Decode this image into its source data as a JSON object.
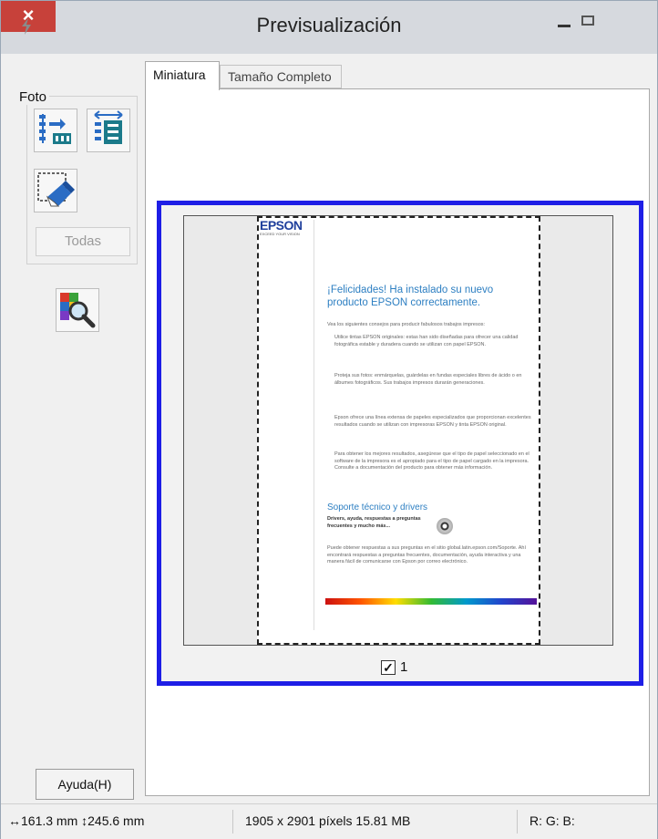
{
  "window": {
    "title": "Previsualización",
    "close_glyph": "×"
  },
  "sidebar": {
    "group_label": "Foto",
    "all_button_label": "Todas",
    "help_button_label": "Ayuda(H)",
    "tool_icons": [
      "auto-locate-icon",
      "size-icon",
      "marquee-delete-icon",
      "color-palette-icon"
    ]
  },
  "tabs": [
    {
      "label": "Miniatura",
      "active": true
    },
    {
      "label": "Tamaño Completo",
      "active": false
    }
  ],
  "preview": {
    "document": {
      "logo": "EPSON",
      "tagline": "EXCEED YOUR VISION",
      "heading": "¡Felicidades! Ha instalado su nuevo producto EPSON correctamente.",
      "intro": "Vea los siguientes consejos para producir fabulosos trabajos impresos:",
      "bullets": [
        "Utilice tintas EPSON originales: estas han sido diseñadas para ofrecer una calidad fotográfica estable y duradera cuando se utilizan con papel EPSON.",
        "Proteja sus fotos: enmárquelas, guárdelas en fundas especiales libres de ácido o en álbumes fotográficos. Sus trabajos impresos durarán generaciones.",
        "Epson ofrece una línea extensa de papeles especializados que proporcionan excelentes resultados cuando se utilizan con impresoras EPSON y tinta EPSON original.",
        "Para obtener los mejores resultados, asegúrese que el tipo de papel seleccionado en el software de la impresora es el apropiado para el tipo de papel cargado en la impresora. Consulte a documentación del producto para obtener más información."
      ],
      "support_heading": "Soporte técnico y drivers",
      "support_bold": "Drivers, ayuda, respuestas a preguntas frecuentes y mucho más...",
      "support_text": "Puede obtener respuestas a sus preguntas en el sitio global.latin.epson.com/Soporte. Ahí encontrará respuestas a preguntas frecuentes, documentación, ayuda interactiva y una manera fácil de comunicarse con Epson por correo electrónico."
    },
    "thumbnail_checkbox": {
      "checked": true,
      "label": "1"
    }
  },
  "status": {
    "dimensions": "↔161.3 mm ↕245.6 mm",
    "pixels_size": "1905 x 2901 píxels 15.81 MB",
    "rgb": "R: G: B:"
  }
}
